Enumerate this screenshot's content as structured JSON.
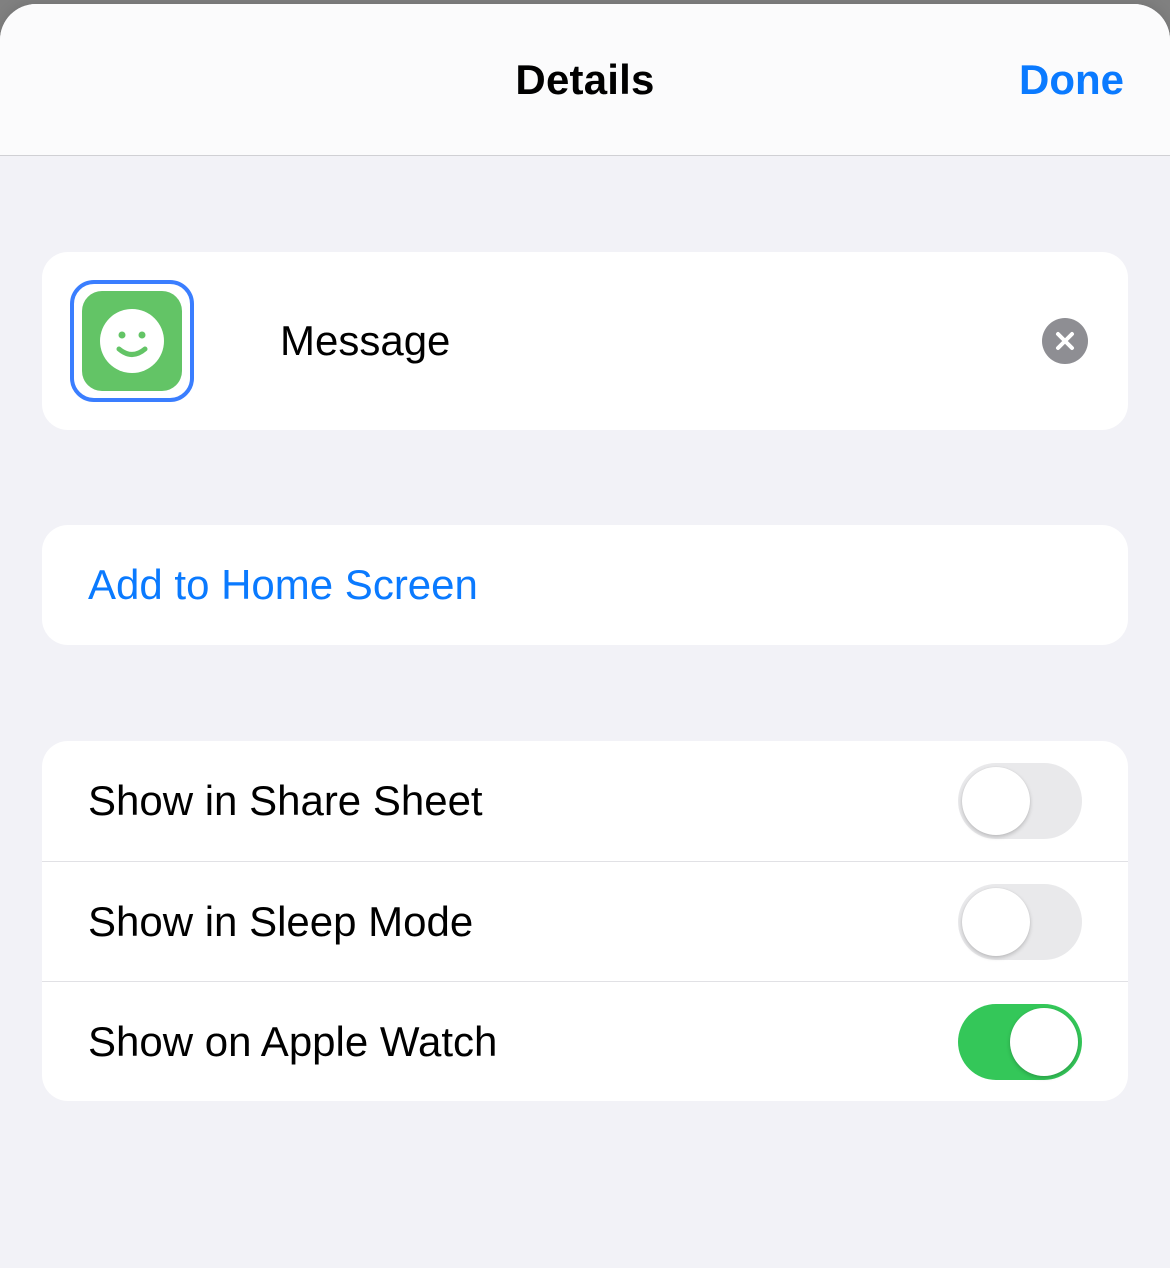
{
  "navbar": {
    "title": "Details",
    "done_label": "Done"
  },
  "shortcut": {
    "name": "Message",
    "icon_name": "smiley-icon",
    "icon_bg_color": "#63c466"
  },
  "actions": {
    "add_to_home_screen_label": "Add to Home Screen"
  },
  "toggles": [
    {
      "label": "Show in Share Sheet",
      "value": false
    },
    {
      "label": "Show in Sleep Mode",
      "value": false
    },
    {
      "label": "Show on Apple Watch",
      "value": true
    }
  ]
}
